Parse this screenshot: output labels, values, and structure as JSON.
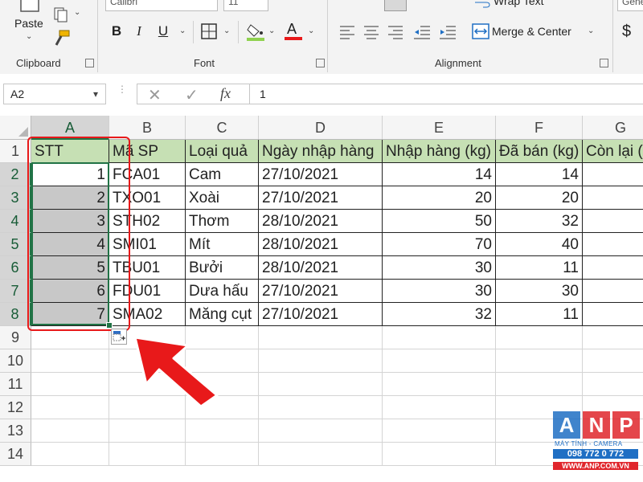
{
  "ribbon": {
    "paste_label": "Paste",
    "clipboard_label": "Clipboard",
    "font_label": "Font",
    "alignment_label": "Alignment",
    "font_name": "Calibri",
    "font_size": "11",
    "wrap_text_label": "Wrap Text",
    "merge_center_label": "Merge & Center",
    "number_format": "General",
    "currency_symbol": "$",
    "bold": "B",
    "italic": "I",
    "underline": "U",
    "font_color_glyph": "A"
  },
  "formula_bar": {
    "name_box": "A2",
    "fx": "fx",
    "value": "1"
  },
  "columns": [
    "A",
    "B",
    "C",
    "D",
    "E",
    "F",
    "G"
  ],
  "rows": [
    "1",
    "2",
    "3",
    "4",
    "5",
    "6",
    "7",
    "8",
    "9",
    "10",
    "11",
    "12",
    "13",
    "14"
  ],
  "table": {
    "headers": [
      "STT",
      "Mã SP",
      "Loại quả",
      "Ngày nhập hàng",
      "Nhập hàng (kg)",
      "Đã bán (kg)",
      "Còn lại (kg)"
    ],
    "rows": [
      [
        "1",
        "FCA01",
        "Cam",
        "27/10/2021",
        "14",
        "14"
      ],
      [
        "2",
        "TXO01",
        "Xoài",
        "27/10/2021",
        "20",
        "20"
      ],
      [
        "3",
        "STH02",
        "Thơm",
        "28/10/2021",
        "50",
        "32"
      ],
      [
        "4",
        "SMI01",
        "Mít",
        "28/10/2021",
        "70",
        "40"
      ],
      [
        "5",
        "TBU01",
        "Bưởi",
        "28/10/2021",
        "30",
        "11"
      ],
      [
        "6",
        "FDU01",
        "Dưa hấu",
        "27/10/2021",
        "30",
        "30"
      ],
      [
        "7",
        "SMA02",
        "Măng cụt",
        "27/10/2021",
        "32",
        "11"
      ]
    ]
  },
  "watermark": {
    "letters": [
      "A",
      "N",
      "P"
    ],
    "line1": "MÁY TÍNH - CAMERA",
    "line2": "098 772 0 772",
    "line3": "WWW.ANP.COM.VN"
  },
  "colors": {
    "header_fill": "#c6e0b4",
    "selection_gray": "#c8c8c8",
    "excel_green": "#217346",
    "annotation_red": "#e8191a",
    "anp_blue": "#1f6fc4",
    "anp_red": "#e0262c"
  }
}
